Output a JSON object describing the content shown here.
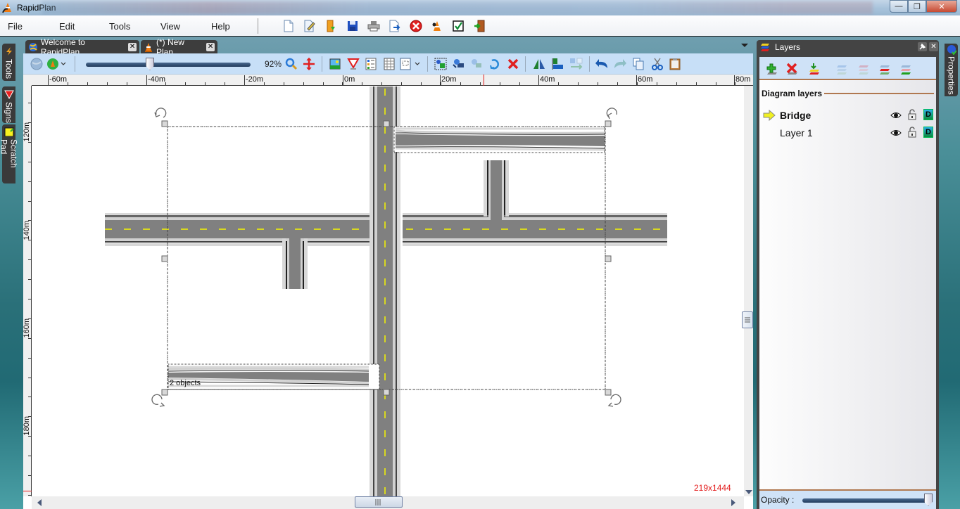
{
  "window": {
    "title": "RapidPlan",
    "controls": {
      "minimize": "—",
      "maximize": "❐",
      "close": "✕"
    }
  },
  "menu": {
    "items": [
      "File",
      "Edit",
      "Tools",
      "View",
      "Help"
    ]
  },
  "main_toolbar": {
    "tools": [
      "new-document-icon",
      "edit-document-icon",
      "open-folder-icon",
      "save-icon",
      "print-icon",
      "export-icon",
      "close-red-icon",
      "traffic-cone-worker-icon",
      "checkbox-icon",
      "exit-door-icon"
    ]
  },
  "side_tabs": {
    "left": [
      "Tools",
      "Signs",
      "Scratch Pad"
    ],
    "right": [
      "Properties"
    ]
  },
  "doc_tabs": [
    {
      "label": "Welcome to RapidPlan",
      "close": "✕",
      "active": false
    },
    {
      "label": "(*) New Plan",
      "close": "✕",
      "active": true
    }
  ],
  "editor_toolbar": {
    "zoom_value": "92%",
    "zoom_level_percent": 92
  },
  "rulers": {
    "horizontal": [
      "-60m",
      "-40m",
      "-20m",
      "0m",
      "20m",
      "40m",
      "60m",
      "80m"
    ],
    "vertical": [
      "120m",
      "140m",
      "160m",
      "180m"
    ]
  },
  "canvas": {
    "selection_label": "2 objects",
    "size_readout": "219x1444"
  },
  "layers_panel": {
    "title": "Layers",
    "section_title": "Diagram layers",
    "layers": [
      {
        "name": "Bridge",
        "active": true,
        "visible": true,
        "locked": false,
        "d_label": "D"
      },
      {
        "name": "Layer 1",
        "active": false,
        "visible": true,
        "locked": false,
        "d_label": "D"
      }
    ],
    "opacity_label": "Opacity :",
    "opacity_percent": 100
  },
  "colors": {
    "road_surface": "#808080",
    "road_edge": "#d0d0d0",
    "lane_marking": "#d8d820",
    "accent_line": "#b07850",
    "size_readout": "#e31b1b",
    "toolbar_bg": "#c7dff7"
  }
}
